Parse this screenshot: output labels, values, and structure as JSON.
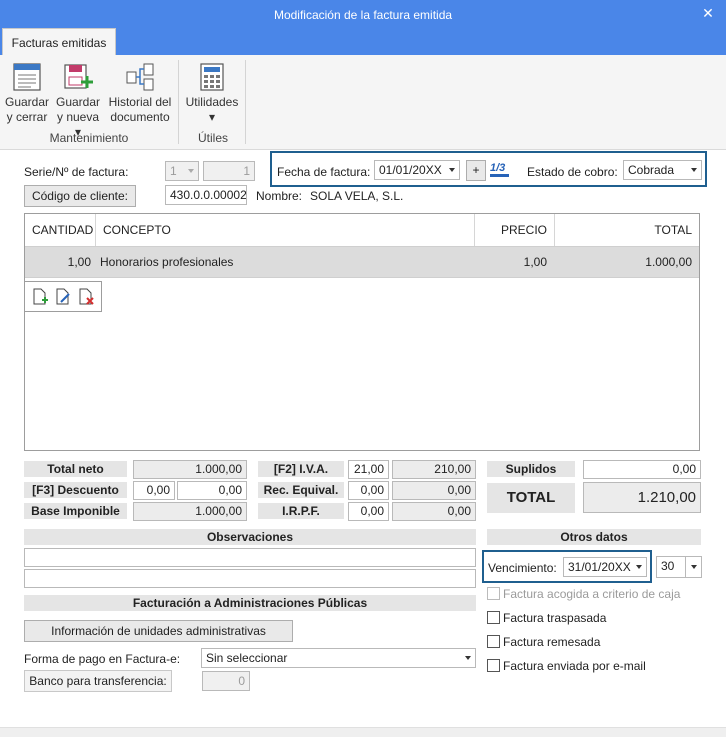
{
  "window": {
    "title": "Modificación de la factura emitida",
    "close": "✕"
  },
  "ribbon": {
    "tab": "Facturas emitidas",
    "buttons": {
      "save_close_1": "Guardar",
      "save_close_2": "y cerrar",
      "save_new_1": "Guardar",
      "save_new_2": "y nueva ▾",
      "history_1": "Historial del",
      "history_2": "documento",
      "utilities_1": "Utilidades",
      "utilities_2": "▾"
    },
    "groups": {
      "maintenance": "Mantenimiento",
      "utilities": "Útiles"
    }
  },
  "header": {
    "serie_label": "Serie/Nº de factura:",
    "serie_value": "1",
    "number_value": "1",
    "client_code_button": "Código de cliente:",
    "client_code_value": "430.0.0.00002",
    "name_label": "Nombre:",
    "name_value": "SOLA VELA, S.L.",
    "date_label": "Fecha de factura:",
    "date_value": "01/01/20XX",
    "plus_button": "+",
    "status_label": "Estado de cobro:",
    "status_value": "Cobrada"
  },
  "lines": {
    "columns": {
      "qty": "CANTIDAD",
      "concept": "CONCEPTO",
      "price": "PRECIO UD.",
      "total": "TOTAL"
    },
    "rows": [
      {
        "qty": "1,00",
        "concept": "Honorarios profesionales",
        "price": "1,00",
        "total": "1.000,00"
      }
    ]
  },
  "totals": {
    "net_label": "Total neto",
    "net_value": "1.000,00",
    "discount_label": "[F3] Descuento",
    "discount_pct": "0,00",
    "discount_value": "0,00",
    "base_label": "Base Imponible",
    "base_value": "1.000,00",
    "iva_label": "[F2] I.V.A.",
    "iva_pct": "21,00",
    "iva_value": "210,00",
    "rec_label": "Rec. Equival.",
    "rec_pct": "0,00",
    "rec_value": "0,00",
    "irpf_label": "I.R.P.F.",
    "irpf_pct": "0,00",
    "irpf_value": "0,00",
    "suplidos_label": "Suplidos",
    "suplidos_value": "0,00",
    "total_label": "TOTAL",
    "total_value": "1.210,00"
  },
  "observations": {
    "title": "Observaciones"
  },
  "efactura": {
    "title": "Facturación a Administraciones Públicas",
    "units_button": "Información de unidades administrativas",
    "payment_label": "Forma de pago en Factura-e:",
    "payment_value": "Sin seleccionar",
    "bank_button": "Banco para transferencia:",
    "bank_value": "0"
  },
  "other": {
    "title": "Otros datos",
    "due_label": "Vencimiento:",
    "due_value": "31/01/20XX",
    "days_value": "30",
    "checks": {
      "cash": "Factura acogida a criterio de caja",
      "transferred": "Factura traspasada",
      "remitted": "Factura remesada",
      "emailed": "Factura enviada por e-mail"
    }
  }
}
